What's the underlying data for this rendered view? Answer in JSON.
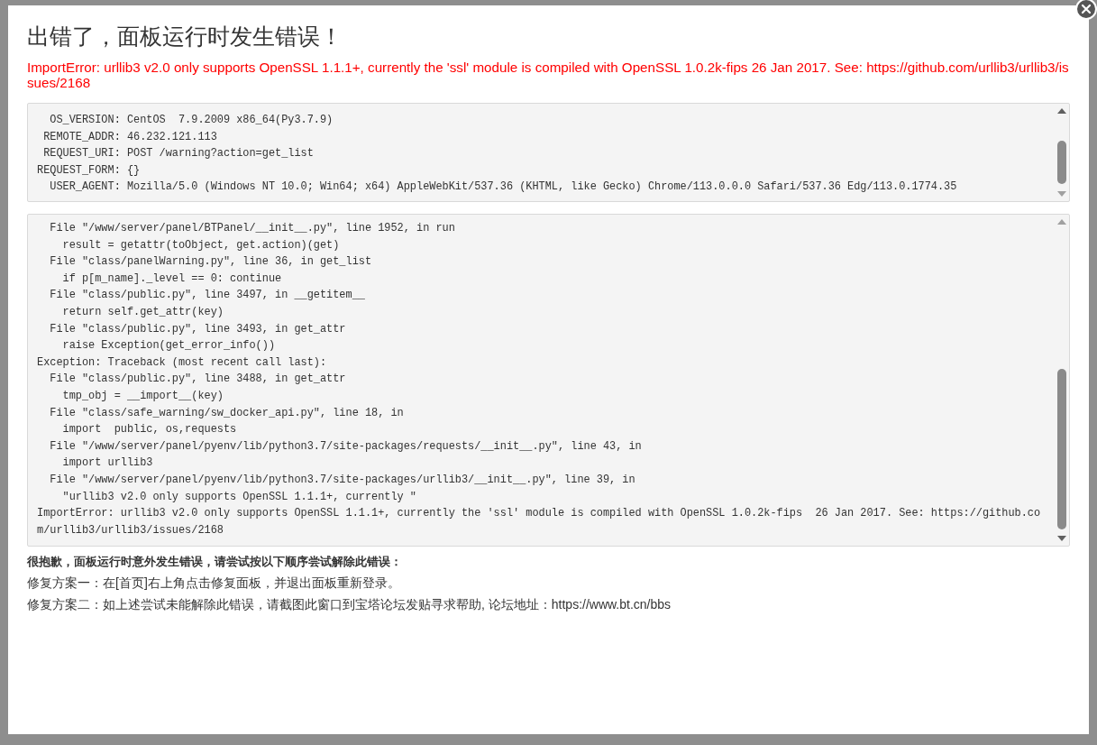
{
  "dialog": {
    "title": "出错了，面板运行时发生错误！",
    "error_message": "ImportError: urllib3 v2.0 only supports OpenSSL 1.1.1+, currently the 'ssl' module is compiled with OpenSSL 1.0.2k-fips 26 Jan 2017. See: https://github.com/urllib3/urllib3/issues/2168",
    "environment_lines": [
      "  OS_VERSION: CentOS  7.9.2009 x86_64(Py3.7.9)",
      " REMOTE_ADDR: 46.232.121.113",
      " REQUEST_URI: POST /warning?action=get_list",
      "REQUEST_FORM: {}",
      "  USER_AGENT: Mozilla/5.0 (Windows NT 10.0; Win64; x64) AppleWebKit/537.36 (KHTML, like Gecko) Chrome/113.0.0.0 Safari/537.36 Edg/113.0.1774.35"
    ],
    "traceback_lines": [
      "  File \"/www/server/panel/BTPanel/__init__.py\", line 1952, in run",
      "    result = getattr(toObject, get.action)(get)",
      "  File \"class/panelWarning.py\", line 36, in get_list",
      "    if p[m_name]._level == 0: continue",
      "  File \"class/public.py\", line 3497, in __getitem__",
      "    return self.get_attr(key)",
      "  File \"class/public.py\", line 3493, in get_attr",
      "    raise Exception(get_error_info())",
      "Exception: Traceback (most recent call last):",
      "  File \"class/public.py\", line 3488, in get_attr",
      "    tmp_obj = __import__(key)",
      "  File \"class/safe_warning/sw_docker_api.py\", line 18, in",
      "    import  public, os,requests",
      "  File \"/www/server/panel/pyenv/lib/python3.7/site-packages/requests/__init__.py\", line 43, in",
      "    import urllib3",
      "  File \"/www/server/panel/pyenv/lib/python3.7/site-packages/urllib3/__init__.py\", line 39, in",
      "    \"urllib3 v2.0 only supports OpenSSL 1.1.1+, currently \"",
      "ImportError: urllib3 v2.0 only supports OpenSSL 1.1.1+, currently the 'ssl' module is compiled with OpenSSL 1.0.2k-fips  26 Jan 2017. See: https://github.co",
      "m/urllib3/urllib3/issues/2168"
    ],
    "help": {
      "heading": "很抱歉，面板运行时意外发生错误，请尝试按以下顺序尝试解除此错误：",
      "lines": [
        "修复方案一：在[首页]右上角点击修复面板，并退出面板重新登录。",
        "修复方案二：如上述尝试未能解除此错误，请截图此窗口到宝塔论坛发贴寻求帮助, 论坛地址：https://www.bt.cn/bbs"
      ]
    }
  }
}
